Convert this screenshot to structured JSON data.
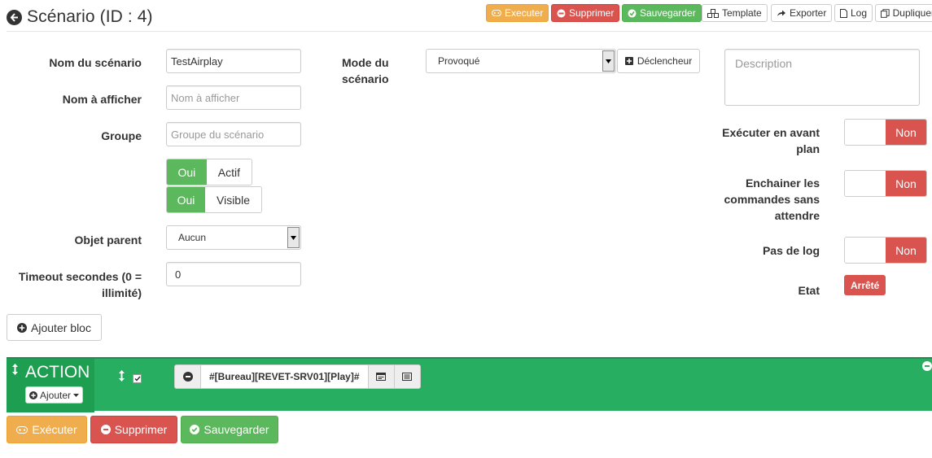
{
  "header": {
    "title": "Scénario (ID : 4)",
    "buttons": {
      "execute": "Executer",
      "delete": "Supprimer",
      "save": "Sauvegarder",
      "template": "Template",
      "export": "Exporter",
      "log": "Log",
      "duplicate": "Dupliquer"
    }
  },
  "form": {
    "name_label": "Nom du scénario",
    "name_value": "TestAirplay",
    "display_label": "Nom à afficher",
    "display_placeholder": "Nom à afficher",
    "group_label": "Groupe",
    "group_placeholder": "Groupe du scénario",
    "active_on": "Oui",
    "active_label": "Actif",
    "visible_on": "Oui",
    "visible_label": "Visible",
    "parent_label": "Objet parent",
    "parent_value": "Aucun",
    "timeout_label_1": "Timeout secondes (0 =",
    "timeout_label_2": "illimité)",
    "timeout_value": "0",
    "mode_label_1": "Mode du",
    "mode_label_2": "scénario",
    "mode_value": "Provoqué",
    "trigger_button": "Déclencheur",
    "description_placeholder": "Description",
    "foreground_label_1": "Exécuter en avant",
    "foreground_label_2": "plan",
    "foreground_value": "Non",
    "chain_label_1": "Enchainer les",
    "chain_label_2": "commandes sans",
    "chain_label_3": "attendre",
    "chain_value": "Non",
    "nolog_label": "Pas de log",
    "nolog_value": "Non",
    "state_label": "Etat",
    "state_value": "Arrêté",
    "state_color": "#d9534f"
  },
  "add_block_button": "Ajouter bloc",
  "block": {
    "title": "ACTION",
    "add_button": "Ajouter",
    "command": "#[Bureau][REVET-SRV01][Play]#",
    "color": "#27ae60"
  },
  "footer": {
    "execute": "Exécuter",
    "delete": "Supprimer",
    "save": "Sauvegarder"
  }
}
